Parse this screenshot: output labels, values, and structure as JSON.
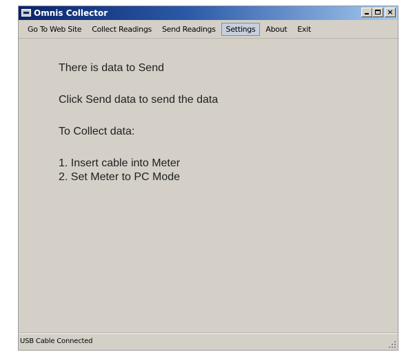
{
  "window": {
    "title": "Omnis Collector",
    "close_glyph": "×"
  },
  "menu": {
    "items": [
      {
        "label": "Go To Web Site"
      },
      {
        "label": "Collect Readings"
      },
      {
        "label": "Send Readings"
      },
      {
        "label": "Settings",
        "active": true
      },
      {
        "label": "About"
      },
      {
        "label": "Exit"
      }
    ]
  },
  "content": {
    "status_message": "There is data to Send",
    "send_instruction": "Click Send data to send the data",
    "collect_heading": "To Collect data:",
    "steps": [
      "1. Insert cable into Meter",
      "2. Set Meter to PC Mode"
    ]
  },
  "statusbar": {
    "text": "USB Cable Connected"
  },
  "colors": {
    "titlebar_start": "#0a246a",
    "titlebar_end": "#a6caf0",
    "window_bg": "#d4d0c8",
    "active_menu_bg": "#c6cfdc"
  },
  "icons": {
    "app": "app-icon",
    "minimize": "minimize-icon",
    "maximize": "maximize-icon",
    "close": "close-icon",
    "resize": "resize-grip-icon"
  }
}
